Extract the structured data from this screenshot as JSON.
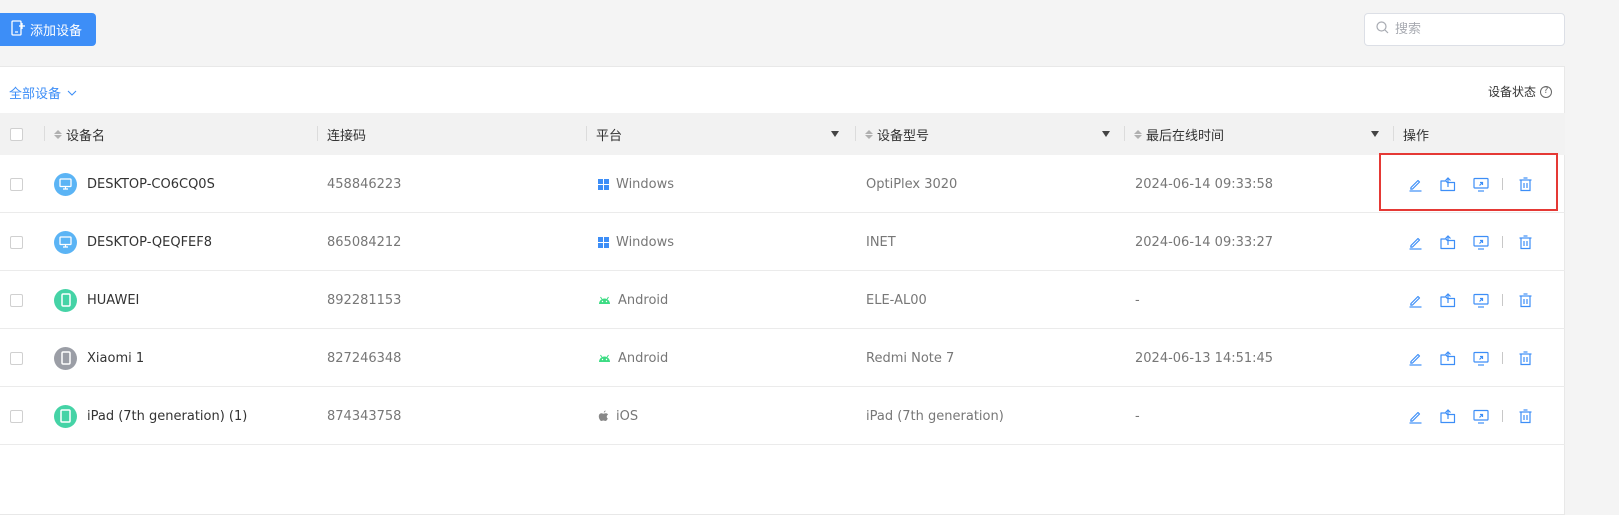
{
  "toolbar": {
    "add_label": "添加设备"
  },
  "search": {
    "placeholder": "搜索"
  },
  "filter": {
    "label": "全部设备"
  },
  "status": {
    "label": "设备状态",
    "help": "?"
  },
  "columns": {
    "name": "设备名",
    "code": "连接码",
    "platform": "平台",
    "model": "设备型号",
    "last_online": "最后在线时间",
    "actions": "操作"
  },
  "rows": [
    {
      "name": "DESKTOP-CO6CQ0S",
      "code": "458846223",
      "platform": "Windows",
      "platform_icon": "windows-icon",
      "model": "OptiPlex 3020",
      "last_online": "2024-06-14 09:33:58",
      "device_icon": "monitor-icon",
      "icon_color": "#5bb4f5"
    },
    {
      "name": "DESKTOP-QEQFEF8",
      "code": "865084212",
      "platform": "Windows",
      "platform_icon": "windows-icon",
      "model": "INET",
      "last_online": "2024-06-14 09:33:27",
      "device_icon": "monitor-icon",
      "icon_color": "#5bb4f5"
    },
    {
      "name": "HUAWEI",
      "code": "892281153",
      "platform": "Android",
      "platform_icon": "android-icon",
      "model": "ELE-AL00",
      "last_online": "-",
      "device_icon": "phone-icon",
      "icon_color": "#45d3a6"
    },
    {
      "name": "Xiaomi 1",
      "code": "827246348",
      "platform": "Android",
      "platform_icon": "android-icon",
      "model": "Redmi Note 7",
      "last_online": "2024-06-13 14:51:45",
      "device_icon": "phone-icon",
      "icon_color": "#9b9ea6"
    },
    {
      "name": "iPad (7th generation) (1)",
      "code": "874343758",
      "platform": "iOS",
      "platform_icon": "apple-icon",
      "model": "iPad (7th generation)",
      "last_online": "-",
      "device_icon": "tablet-icon",
      "icon_color": "#45d3a6"
    }
  ],
  "colors": {
    "accent": "#3d8ef7",
    "highlight_border": "#e53935",
    "windows": "#3d8ef7",
    "android": "#3ddc84",
    "apple": "#888888"
  }
}
